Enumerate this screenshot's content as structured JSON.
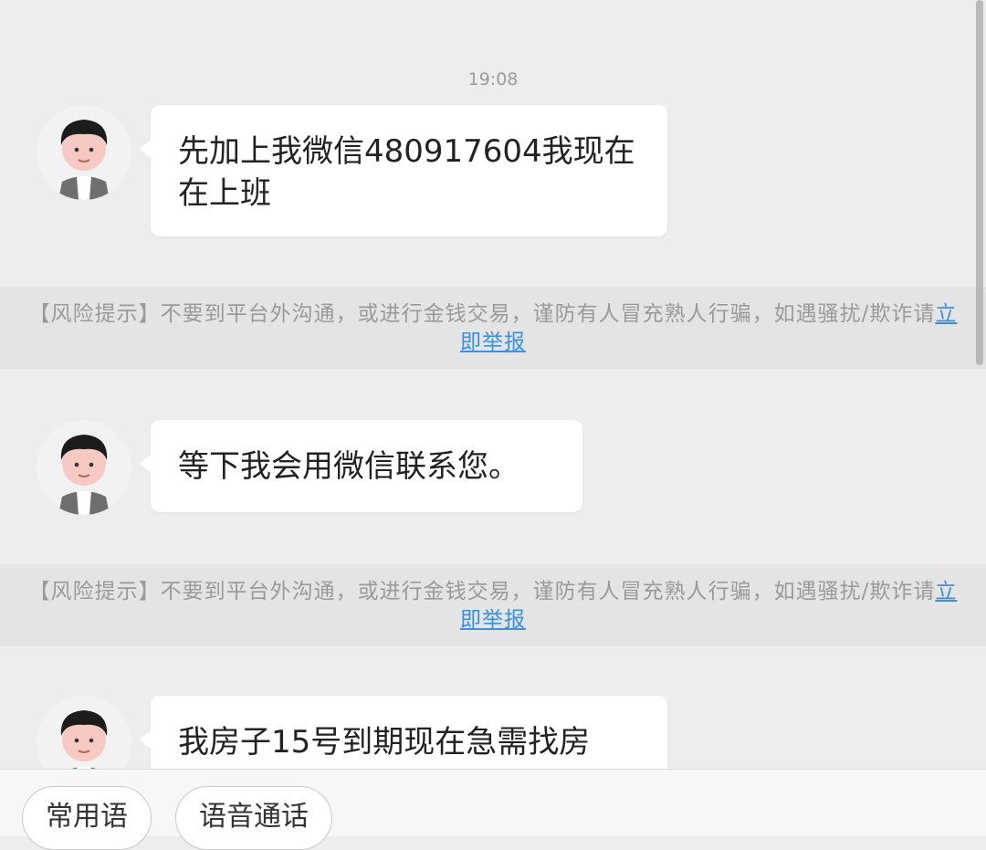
{
  "timestamp": "19:08",
  "messages": [
    {
      "text": "先加上我微信480917604我现在在上班"
    },
    {
      "text": "等下我会用微信联系您。"
    },
    {
      "text": "我房子15号到期现在急需找房"
    }
  ],
  "risk_notice": {
    "text": "【风险提示】不要到平台外沟通，或进行金钱交易，谨防有人冒充熟人行骗，如遇骚扰/欺诈请",
    "link": "立即举报"
  },
  "bottom_bar": {
    "quick_phrases": "常用语",
    "voice_call": "语音通话"
  },
  "colors": {
    "background": "#ededed",
    "bubble": "#ffffff",
    "link": "#3d8fe0",
    "notice_band": "#e4e4e4"
  },
  "icons": {
    "avatar": "male-avatar-icon"
  }
}
